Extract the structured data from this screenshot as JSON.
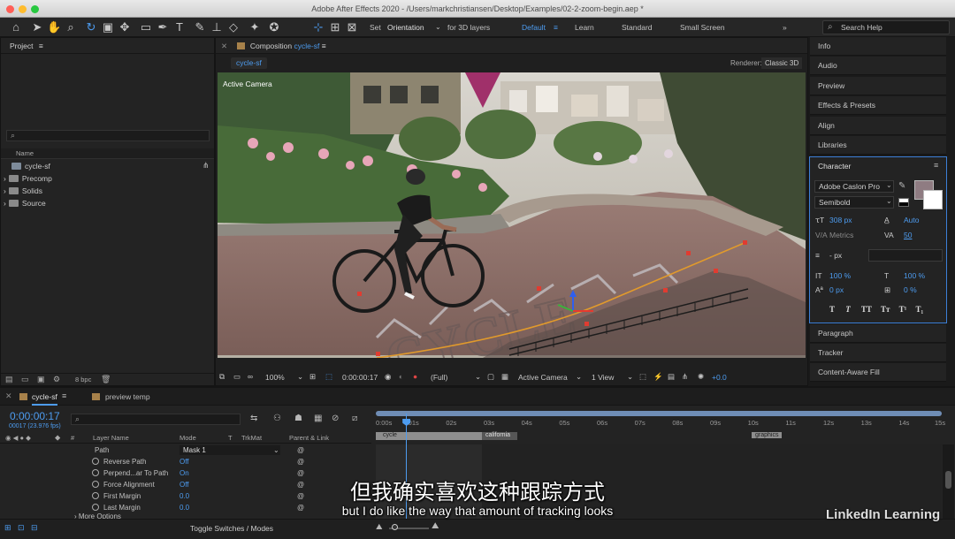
{
  "window": {
    "title": "Adobe After Effects 2020 - /Users/markchristiansen/Desktop/Examples/02-2-zoom-begin.aep *"
  },
  "toolbar": {
    "set": "Set",
    "orientation": "Orientation",
    "for3d": "for 3D layers",
    "default": "Default",
    "learn": "Learn",
    "standard": "Standard",
    "small_screen": "Small Screen",
    "search_placeholder": "Search Help"
  },
  "project": {
    "title": "Project",
    "columns": {
      "name": "Name"
    },
    "items": [
      {
        "label": "cycle-sf",
        "type": "composition"
      },
      {
        "label": "Precomp",
        "type": "folder"
      },
      {
        "label": "Solids",
        "type": "folder"
      },
      {
        "label": "Source",
        "type": "folder"
      }
    ],
    "bpc": "8 bpc"
  },
  "composition": {
    "title": "Composition",
    "name": "cycle-sf",
    "tab": "cycle-sf",
    "renderer_label": "Renderer:",
    "renderer": "Classic 3D",
    "camera_label": "Active Camera",
    "overlay_text": "CYCLE"
  },
  "viewer_bar": {
    "zoom": "100%",
    "timecode": "0:00:00:17",
    "resolution": "(Full)",
    "camera": "Active Camera",
    "views": "1 View",
    "exposure": "+0.0"
  },
  "right_tabs": {
    "info": "Info",
    "audio": "Audio",
    "preview": "Preview",
    "effects": "Effects & Presets",
    "align": "Align",
    "libraries": "Libraries",
    "paragraph": "Paragraph",
    "tracker": "Tracker",
    "content_aware": "Content-Aware Fill"
  },
  "character": {
    "title": "Character",
    "font": "Adobe Caslon Pro",
    "style": "Semibold",
    "size": "308 px",
    "leading": "Auto",
    "kerning": "Metrics",
    "tracking": "50",
    "stroke": "- px",
    "vscale": "100 %",
    "hscale": "100 %",
    "baseline": "0 px",
    "tsume": "0 %",
    "swatch": "#8f7c82",
    "type_buttons": [
      "T",
      "T",
      "TT",
      "Tт",
      "T¹",
      "T₁"
    ]
  },
  "timeline": {
    "tab": "cycle-sf",
    "tab2": "preview temp",
    "timecode": "0:00:00:17",
    "fps": "00017 (23.976 fps)",
    "headers": {
      "layer_name": "Layer Name",
      "mode": "Mode",
      "t": "T",
      "trkmat": "TrkMat",
      "parent": "Parent & Link"
    },
    "ticks": [
      "0:00s",
      "01s",
      "02s",
      "03s",
      "04s",
      "05s",
      "06s",
      "07s",
      "08s",
      "09s",
      "10s",
      "11s",
      "12s",
      "13s",
      "14s",
      "15s"
    ],
    "markers": [
      "cycle",
      "california",
      "graphics"
    ],
    "rows": [
      {
        "name": "Path",
        "value": "Mask 1"
      },
      {
        "name": "Reverse Path",
        "value": "Off"
      },
      {
        "name": "Perpend...ar To Path",
        "value": "On"
      },
      {
        "name": "Force Alignment",
        "value": "Off"
      },
      {
        "name": "First Margin",
        "value": "0.0"
      },
      {
        "name": "Last Margin",
        "value": "0.0"
      },
      {
        "name": "More Options",
        "value": ""
      }
    ],
    "toggle": "Toggle Switches / Modes",
    "playhead_fraction": 0.08
  },
  "subtitles": {
    "zh": "但我确实喜欢这种跟踪方式",
    "en": "but I do like the way that amount of tracking looks"
  },
  "watermark": "LinkedIn Learning"
}
